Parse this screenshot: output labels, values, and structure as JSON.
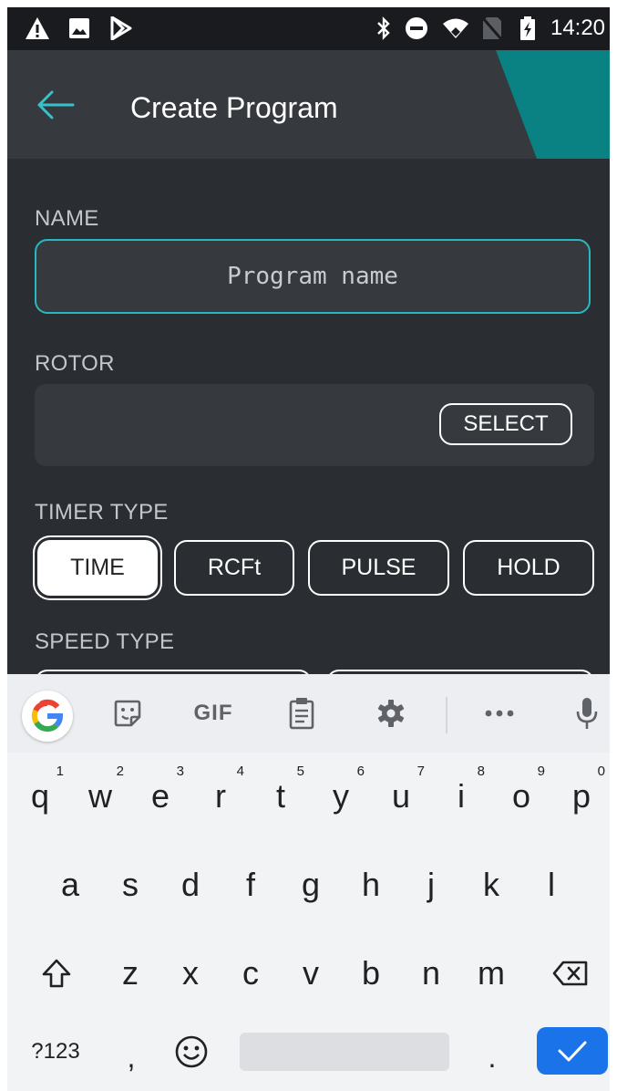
{
  "status_bar": {
    "time": "14:20",
    "left_icons": [
      "warning-icon",
      "image-icon",
      "play-store-icon"
    ],
    "right_icons": [
      "bluetooth-icon",
      "do-not-disturb-icon",
      "wifi-icon",
      "no-sim-icon",
      "battery-charging-icon"
    ]
  },
  "app_bar": {
    "title": "Create Program",
    "accent_color": "#0a8284"
  },
  "form": {
    "name_label": "NAME",
    "name_placeholder": "Program name",
    "name_value": "",
    "rotor_label": "ROTOR",
    "rotor_button": "SELECT",
    "timer_type_label": "TIMER TYPE",
    "timer_types": [
      "TIME",
      "RCFt",
      "PULSE",
      "HOLD"
    ],
    "timer_type_selected": "TIME",
    "speed_type_label": "SPEED TYPE"
  },
  "keyboard": {
    "suggestion_bar": [
      "google-icon",
      "sticker-icon",
      "GIF",
      "clipboard-icon",
      "settings-icon",
      "more-icon",
      "mic-icon"
    ],
    "row1": [
      "q",
      "w",
      "e",
      "r",
      "t",
      "y",
      "u",
      "i",
      "o",
      "p"
    ],
    "row1_hints": [
      "1",
      "2",
      "3",
      "4",
      "5",
      "6",
      "7",
      "8",
      "9",
      "0"
    ],
    "row2": [
      "a",
      "s",
      "d",
      "f",
      "g",
      "h",
      "j",
      "k",
      "l"
    ],
    "row3": [
      "z",
      "x",
      "c",
      "v",
      "b",
      "n",
      "m"
    ],
    "symbols_key": "?123",
    "comma_key": ",",
    "period_key": ".",
    "accent_color": "#1a73e8"
  }
}
